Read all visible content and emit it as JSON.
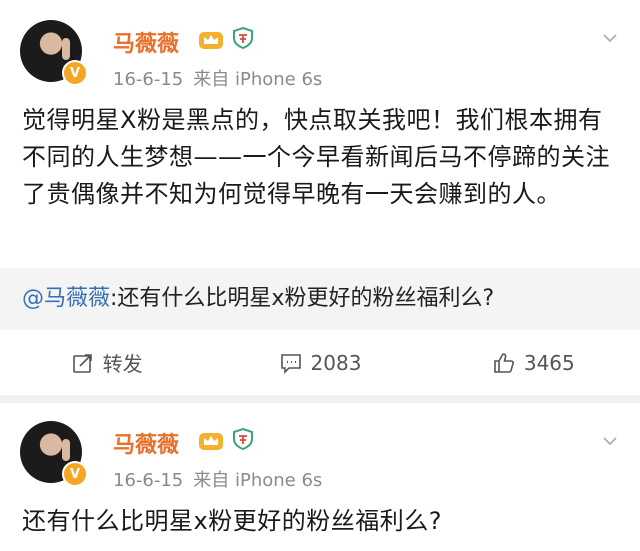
{
  "posts": [
    {
      "author": "马薇薇",
      "verified_badge": "V",
      "date": "16-6-15",
      "source": "来自 iPhone 6s",
      "text": "觉得明星X粉是黑点的，快点取关我吧！我们根本拥有不同的人生梦想——一个今早看新闻后马不停蹄的关注了贵偶像并不知为何觉得早晚有一天会赚到的人。",
      "quoted": {
        "mention": "@马薇薇",
        "text": ":还有什么比明星x粉更好的粉丝福利么?"
      },
      "actions": {
        "repost_label": "转发",
        "comment_count": "2083",
        "like_count": "3465"
      }
    },
    {
      "author": "马薇薇",
      "verified_badge": "V",
      "date": "16-6-15",
      "source": "来自 iPhone 6s",
      "text": "还有什么比明星x粉更好的粉丝福利么?"
    }
  ],
  "icons": {
    "crown": "crown-icon",
    "shield": "shield-badge-icon",
    "chevron": "chevron-down-icon",
    "repost": "repost-icon",
    "comment": "comment-icon",
    "like": "thumbs-up-icon"
  },
  "colors": {
    "author_name": "#e8702a",
    "mention": "#3a6fb4",
    "verified": "#f5a623"
  }
}
